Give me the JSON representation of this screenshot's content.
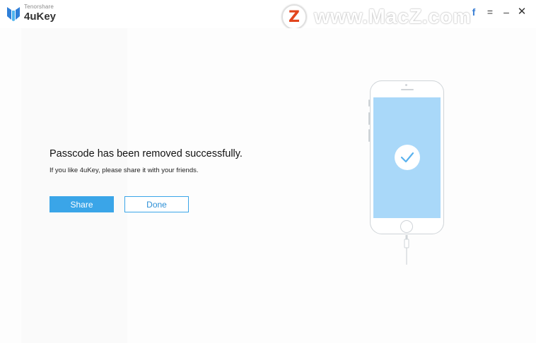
{
  "app": {
    "vendor": "Tenorshare",
    "name": "4uKey",
    "accent_color": "#3aa5e8",
    "logo_icon": "tenorshare-logo-icon"
  },
  "watermark": {
    "badge": "Z",
    "text": "www.MacZ.com"
  },
  "window_controls": {
    "facebook": "f",
    "menu": "=",
    "minimize": "–",
    "close": "✕"
  },
  "result": {
    "headline": "Passcode has been removed successfully.",
    "subline": "If you like 4uKey, please share it with your friends.",
    "share_label": "Share",
    "done_label": "Done"
  },
  "illustration": {
    "device": "iphone-icon",
    "status_icon": "checkmark-icon",
    "screen_color": "#a9d8f9"
  }
}
